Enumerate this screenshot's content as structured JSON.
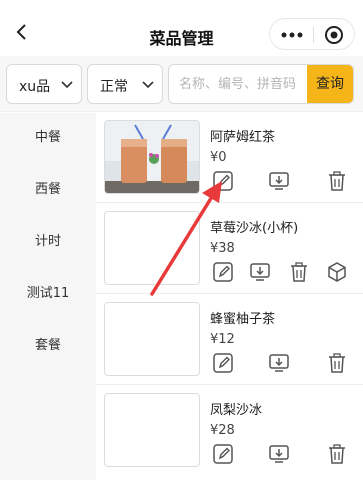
{
  "nav": {
    "title": "菜品管理",
    "back_icon": "chevron-left-icon",
    "more_icon": "more-dots-icon",
    "close_icon": "target-circle-icon"
  },
  "filters": {
    "store": "xu品",
    "status": "正常",
    "search_placeholder": "名称、编号、拼音码",
    "search_button": "查询",
    "accent": "#f5b519"
  },
  "categories": [
    "中餐",
    "西餐",
    "计时",
    "测试11",
    "套餐"
  ],
  "products": [
    {
      "name": "阿萨姆红茶",
      "price": "¥0",
      "has_image": true,
      "actions": [
        "edit-icon",
        "download-icon",
        "trash-icon"
      ]
    },
    {
      "name": "草莓沙冰(小杯)",
      "price": "¥38",
      "has_image": false,
      "actions": [
        "edit-icon",
        "download-icon",
        "trash-icon",
        "box-icon"
      ]
    },
    {
      "name": "蜂蜜柚子茶",
      "price": "¥12",
      "has_image": false,
      "actions": [
        "edit-icon",
        "download-icon",
        "trash-icon"
      ]
    },
    {
      "name": "凤梨沙冰",
      "price": "¥28",
      "has_image": false,
      "actions": [
        "edit-icon",
        "download-icon",
        "trash-icon"
      ]
    }
  ],
  "annotation": {
    "type": "red-arrow",
    "color": "#e83a3a"
  }
}
